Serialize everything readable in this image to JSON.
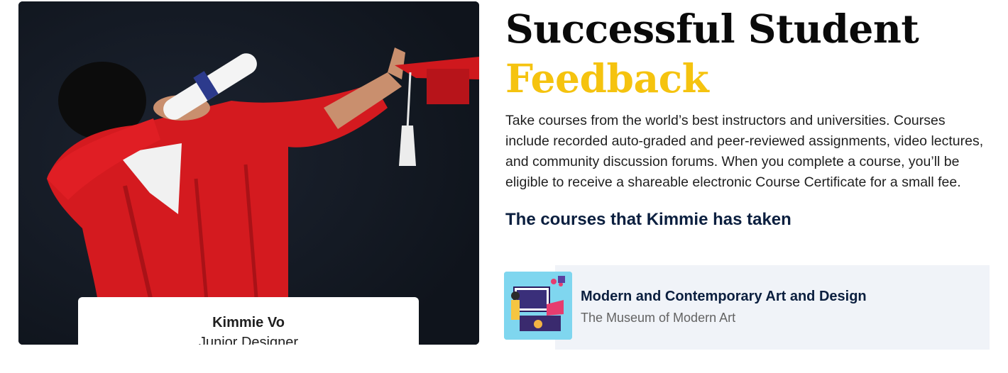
{
  "hero": {
    "title_line1": "Successful Student",
    "title_line2": "Feedback",
    "accent_color": "#f5c30f",
    "description": "Take courses from the world’s best instructors and universities. Courses include recorded auto-graded and peer-reviewed assignments, video lectures, and community discussion forums. When you complete a course, you’ll be eligible to receive a shareable electronic Course Certificate for a small fee."
  },
  "student": {
    "name": "Kimmie Vo",
    "role": "Junior Designer"
  },
  "courses": {
    "heading": "The courses that Kimmie has taken",
    "items": [
      {
        "title": "Modern and Contemporary Art and Design",
        "provider": "The Museum of Modern Art"
      }
    ]
  }
}
